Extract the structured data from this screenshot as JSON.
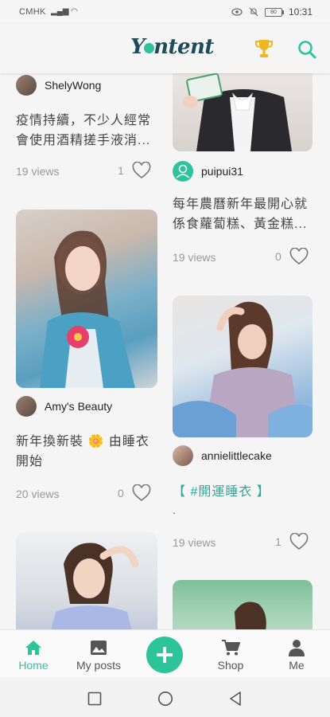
{
  "status": {
    "carrier": "CMHK",
    "signal": "▂▄▆ ◠",
    "battery": "80",
    "time": "10:31"
  },
  "app": {
    "logo_prefix": "Y",
    "logo_suffix": "ntent"
  },
  "posts": [
    {
      "author": "ShelyWong",
      "caption": "疫情持續，不少人經常會使用酒精搓手液消...",
      "views": "19 views",
      "likes": "1"
    },
    {
      "author": "puipui31",
      "caption": "每年農曆新年最開心就係食蘿蔔糕、黃金糕...",
      "views": "19 views",
      "likes": "0"
    },
    {
      "author": "Amy's Beauty",
      "caption": "新年換新裝 🌼 由睡衣開始",
      "views": "20 views",
      "likes": "0"
    },
    {
      "author": "annielittlecake",
      "caption": "【 #開運睡衣 】",
      "caption_extra": ".",
      "views": "19 views",
      "likes": "1"
    }
  ],
  "nav": {
    "home": "Home",
    "myposts": "My posts",
    "shop": "Shop",
    "me": "Me"
  },
  "colors": {
    "accent": "#2ec49a",
    "logo": "#1e4a5c"
  }
}
